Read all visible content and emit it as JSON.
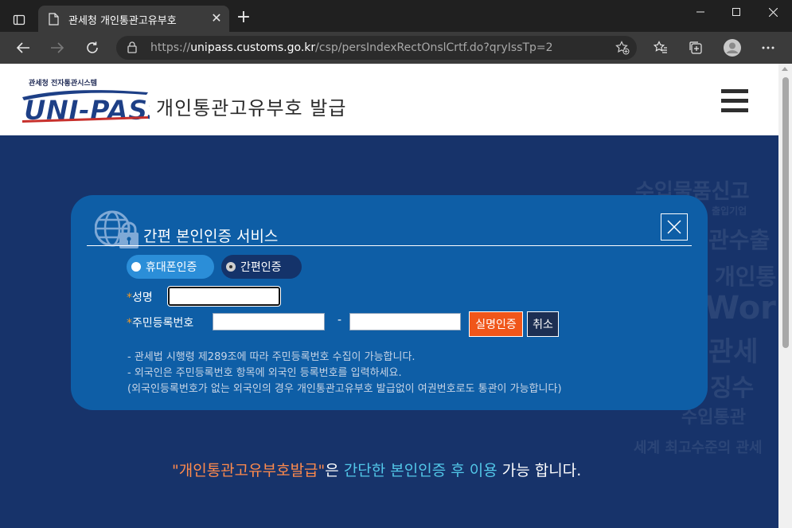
{
  "browser": {
    "tab_title": "관세청 개인통관고유부호",
    "url_prefix": "https://",
    "url_domain": "unipass.customs.go.kr",
    "url_path": "/csp/persIndexRectOnslCrtf.do?qryIssTp=2"
  },
  "header": {
    "logo_small": "관세청 전자통관시스템",
    "logo_main": "UNI-PASS",
    "title": "개인통관고유부호 발급"
  },
  "background_words": [
    "수입물품신고",
    "출입기업",
    "관수출",
    "개인통",
    "World",
    "관세",
    "징수",
    "수입통관",
    "세계 최고수준의 관세"
  ],
  "modal": {
    "title": "간편 본인인증 서비스",
    "radio_phone": "휴대폰인증",
    "radio_simple": "간편인증",
    "selected": "간편인증",
    "name_label": "성명",
    "rrn_label": "주민등록번호",
    "required_mark": "*",
    "dash": "-",
    "verify_button": "실명인증",
    "cancel_button": "취소",
    "notes": [
      "- 관세법 시행령 제289조에 따라 주민등록번호 수집이 가능합니다.",
      "- 외국인은 주민등록번호 항목에 외국인 등록번호를 입력하세요.",
      "(외국인등록번호가 없는 외국인의 경우 개인통관고유부호 발급없이 여권번호로도 통관이 가능합니다)"
    ]
  },
  "footer_line": {
    "quoted": "\"개인통관고유부호발급\"",
    "part2": "은 ",
    "highlight": "간단한 본인인증 후 이용",
    "part3": " 가능 합니다."
  }
}
